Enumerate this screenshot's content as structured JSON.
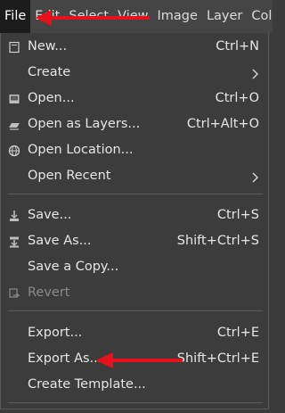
{
  "menubar": {
    "items": [
      {
        "label": "File"
      },
      {
        "label": "Edit"
      },
      {
        "label": "Select"
      },
      {
        "label": "View"
      },
      {
        "label": "Image"
      },
      {
        "label": "Layer"
      },
      {
        "label": "Colo"
      }
    ]
  },
  "menu": {
    "items": [
      {
        "label": "New...",
        "shortcut": "Ctrl+N",
        "icon": "new-image-icon"
      },
      {
        "label": "Create",
        "shortcut": "",
        "submenu": true
      },
      {
        "label": "Open...",
        "shortcut": "Ctrl+O",
        "icon": "open-image-icon"
      },
      {
        "label": "Open as Layers...",
        "shortcut": "Ctrl+Alt+O",
        "icon": "open-layers-icon"
      },
      {
        "label": "Open Location...",
        "shortcut": "",
        "icon": "globe-icon"
      },
      {
        "label": "Open Recent",
        "shortcut": "",
        "submenu": true
      },
      {
        "label": "Save...",
        "shortcut": "Ctrl+S",
        "icon": "save-icon"
      },
      {
        "label": "Save As...",
        "shortcut": "Shift+Ctrl+S",
        "icon": "save-as-icon"
      },
      {
        "label": "Save a Copy...",
        "shortcut": ""
      },
      {
        "label": "Revert",
        "shortcut": "",
        "icon": "revert-icon",
        "disabled": true
      },
      {
        "label": "Export...",
        "shortcut": "Ctrl+E"
      },
      {
        "label": "Export As...",
        "shortcut": "Shift+Ctrl+E"
      },
      {
        "label": "Create Template...",
        "shortcut": ""
      }
    ]
  },
  "colors": {
    "menubar_bg": "#454545",
    "menu_bg": "#3c3c3c",
    "active_bg": "#1b1b1b",
    "annotation_arrow": "#e8101a"
  }
}
